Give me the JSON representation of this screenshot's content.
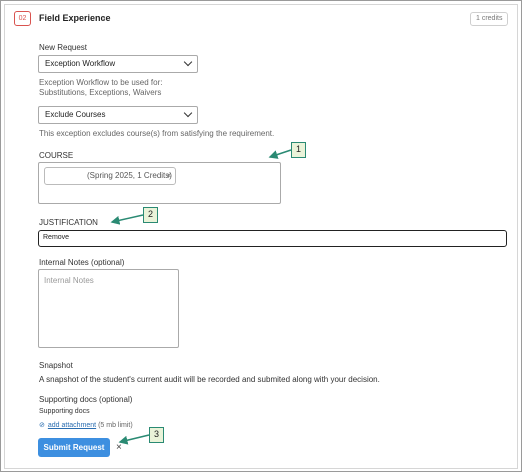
{
  "header": {
    "step_badge": "02",
    "title": "Field Experience",
    "chevron": "›",
    "credits": "1 credits"
  },
  "request": {
    "label": "New Request",
    "workflow_select": "Exception Workflow",
    "workflow_help_line1": "Exception Workflow to be used for:",
    "workflow_help_line2": "Substitutions, Exceptions, Waivers",
    "exception_select": "Exclude Courses",
    "exception_help": "This exception excludes course(s) from satisfying the requirement."
  },
  "course": {
    "label": "COURSE",
    "chip_text": "(Spring 2025, 1 Credits)",
    "chip_remove": "×"
  },
  "justification": {
    "label": "JUSTIFICATION",
    "value": "Remove"
  },
  "notes": {
    "label": "Internal Notes (optional)",
    "placeholder": "Internal Notes"
  },
  "snapshot": {
    "label": "Snapshot",
    "text": "A snapshot of the student's current audit will be recorded and submited along with your decision."
  },
  "supporting": {
    "label": "Supporting docs (optional)",
    "sublabel": "Supporting docs",
    "attach_icon": "⊘",
    "attach_link": "add attachment",
    "attach_limit": "(5 mb limit)"
  },
  "actions": {
    "submit": "Submit Request",
    "cancel": "×"
  },
  "callouts": [
    "1",
    "2",
    "3"
  ],
  "colors": {
    "accent": "#3d8fe0",
    "badge": "#d9534f",
    "callout_border": "#2a8a73",
    "callout_fill": "#eaf3d9"
  }
}
